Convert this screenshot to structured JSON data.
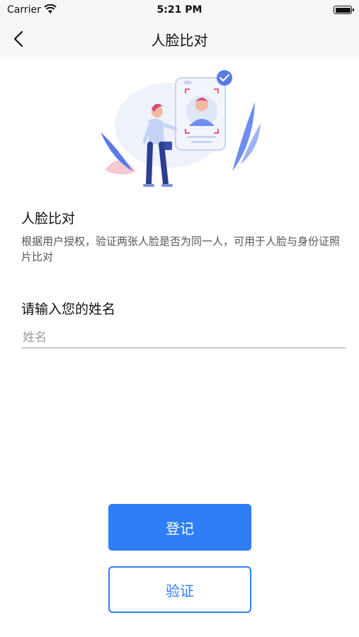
{
  "status_bar": {
    "carrier": "Carrier",
    "time": "5:21 PM"
  },
  "nav": {
    "title": "人脸比对"
  },
  "intro": {
    "title": "人脸比对",
    "description": "根据用户授权，验证两张人脸是否为同一人，可用于人脸与身份证照片比对"
  },
  "form": {
    "name_label": "请输入您的姓名",
    "name_value": "",
    "name_placeholder": "姓名"
  },
  "actions": {
    "register_label": "登记",
    "verify_label": "验证"
  },
  "colors": {
    "accent": "#2f7ef6"
  }
}
